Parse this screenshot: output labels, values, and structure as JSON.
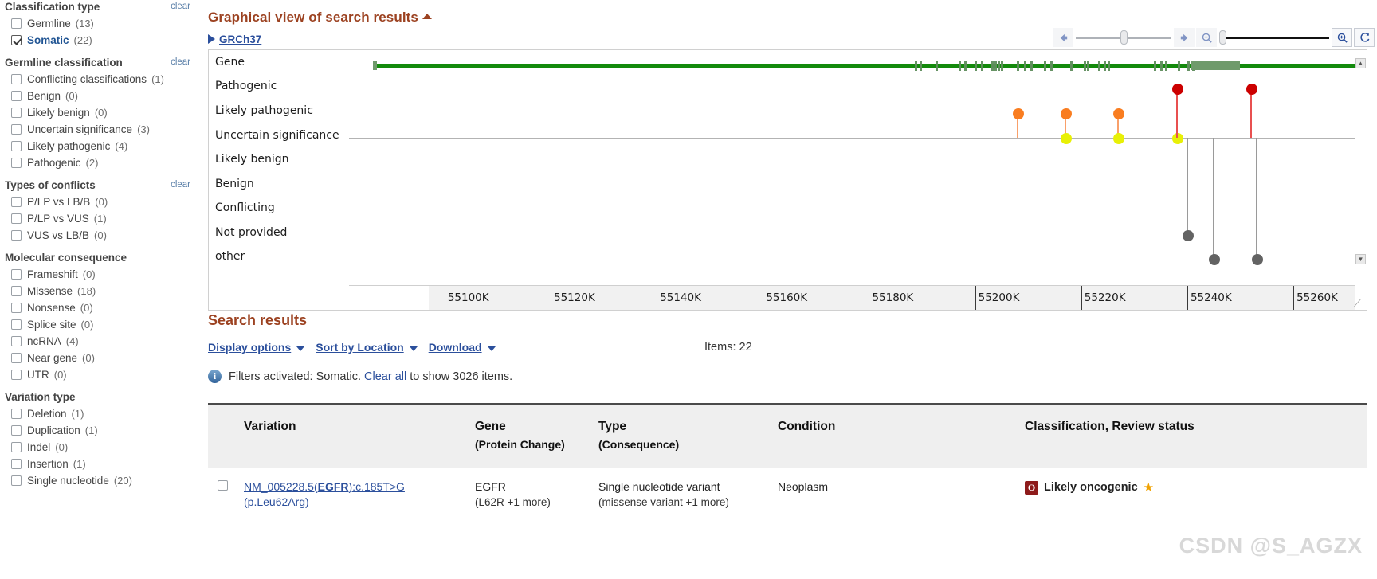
{
  "sidebar": {
    "groups": [
      {
        "title": "Classification type",
        "clear": "clear",
        "items": [
          {
            "label": "Germline",
            "count": "(13)",
            "checked": false
          },
          {
            "label": "Somatic",
            "count": "(22)",
            "checked": true
          }
        ]
      },
      {
        "title": "Germline classification",
        "clear": "clear",
        "items": [
          {
            "label": "Conflicting classifications",
            "count": "(1)",
            "checked": false
          },
          {
            "label": "Benign",
            "count": "(0)",
            "checked": false
          },
          {
            "label": "Likely benign",
            "count": "(0)",
            "checked": false
          },
          {
            "label": "Uncertain significance",
            "count": "(3)",
            "checked": false
          },
          {
            "label": "Likely pathogenic",
            "count": "(4)",
            "checked": false
          },
          {
            "label": "Pathogenic",
            "count": "(2)",
            "checked": false
          }
        ]
      },
      {
        "title": "Types of conflicts",
        "clear": "clear",
        "items": [
          {
            "label": "P/LP vs LB/B",
            "count": "(0)",
            "checked": false
          },
          {
            "label": "P/LP vs VUS",
            "count": "(1)",
            "checked": false
          },
          {
            "label": "VUS vs LB/B",
            "count": "(0)",
            "checked": false
          }
        ]
      },
      {
        "title": "Molecular consequence",
        "clear": "",
        "items": [
          {
            "label": "Frameshift",
            "count": "(0)",
            "checked": false
          },
          {
            "label": "Missense",
            "count": "(18)",
            "checked": false
          },
          {
            "label": "Nonsense",
            "count": "(0)",
            "checked": false
          },
          {
            "label": "Splice site",
            "count": "(0)",
            "checked": false
          },
          {
            "label": "ncRNA",
            "count": "(4)",
            "checked": false
          },
          {
            "label": "Near gene",
            "count": "(0)",
            "checked": false
          },
          {
            "label": "UTR",
            "count": "(0)",
            "checked": false
          }
        ]
      },
      {
        "title": "Variation type",
        "clear": "",
        "items": [
          {
            "label": "Deletion",
            "count": "(1)",
            "checked": false
          },
          {
            "label": "Duplication",
            "count": "(1)",
            "checked": false
          },
          {
            "label": "Indel",
            "count": "(0)",
            "checked": false
          },
          {
            "label": "Insertion",
            "count": "(1)",
            "checked": false
          },
          {
            "label": "Single nucleotide",
            "count": "(20)",
            "checked": false
          }
        ]
      }
    ]
  },
  "graphical_view": {
    "title": "Graphical view of search results",
    "collapse_icon": "caret-up-icon",
    "assembly": "GRCh37",
    "assembly_icon": "triangle-right-icon",
    "toolbar": {
      "pan_left_icon": "arrow-left-icon",
      "pan_right_icon": "arrow-right-icon",
      "zoom_out_icon": "magnifier-minus-icon",
      "zoom_in_icon": "magnifier-plus-icon",
      "reset_icon": "refresh-icon"
    }
  },
  "chart_data": {
    "type": "scatter",
    "title": "Graphical view of search results",
    "xlabel": "",
    "ylabel": "",
    "grid": false,
    "legend": "none",
    "xlim": [
      55082000,
      55272000
    ],
    "x_tick_labels": [
      "55100K",
      "55120K",
      "55140K",
      "55160K",
      "55180K",
      "55200K",
      "55220K",
      "55240K",
      "55260K"
    ],
    "x_tick_values": [
      55100000,
      55120000,
      55140000,
      55160000,
      55180000,
      55200000,
      55220000,
      55240000,
      55260000
    ],
    "tracks": [
      "Gene",
      "Pathogenic",
      "Likely pathogenic",
      "Uncertain significance",
      "Likely benign",
      "Benign",
      "Conflicting",
      "Not provided",
      "other"
    ],
    "gene_track": {
      "name": "EGFR",
      "color": "#138a0c",
      "start": 55086714,
      "end": 55279321
    },
    "markers": [
      {
        "track": "Likely pathogenic",
        "x": 55208000,
        "color": "#f97d20"
      },
      {
        "track": "Likely pathogenic",
        "x": 55217000,
        "color": "#f97d20"
      },
      {
        "track": "Uncertain significance",
        "x": 55217000,
        "color": "#e8f006"
      },
      {
        "track": "Likely pathogenic",
        "x": 55227000,
        "color": "#f97d20"
      },
      {
        "track": "Uncertain significance",
        "x": 55227000,
        "color": "#e8f006"
      },
      {
        "track": "Uncertain significance",
        "x": 55238000,
        "color": "#e8f006"
      },
      {
        "track": "Pathogenic",
        "x": 55238000,
        "color": "#cc0000"
      },
      {
        "track": "Not provided",
        "x": 55240000,
        "color": "#636363"
      },
      {
        "track": "other",
        "x": 55245000,
        "color": "#636363"
      },
      {
        "track": "other",
        "x": 55253000,
        "color": "#636363"
      },
      {
        "track": "Pathogenic",
        "x": 55252000,
        "color": "#cc0000"
      }
    ]
  },
  "search_results": {
    "title": "Search results",
    "display_options": "Display options",
    "sort_by": "Sort by Location",
    "download": "Download",
    "items_count": "Items: 22",
    "filters_note_prefix": "Filters activated: Somatic.",
    "clear_all": "Clear all",
    "filters_note_suffix": "to show 3026 items.",
    "columns": [
      {
        "label": "Variation",
        "sub": ""
      },
      {
        "label": "Gene",
        "sub": "(Protein Change)"
      },
      {
        "label": "Type",
        "sub": "(Consequence)"
      },
      {
        "label": "Condition",
        "sub": ""
      },
      {
        "label": "Classification, Review status",
        "sub": ""
      }
    ],
    "rows": [
      {
        "variation_prefix": "NM_005228.5(",
        "variation_gene": "EGFR",
        "variation_suffix": "):c.185T>G (p.Leu62Arg)",
        "gene": "EGFR",
        "protein_change": "(L62R +1 more)",
        "type": "Single nucleotide variant",
        "consequence": "(missense variant +1 more)",
        "condition": "Neoplasm",
        "classification": "Likely oncogenic",
        "classification_badge": "O",
        "review_star": "★"
      }
    ]
  },
  "watermark": "CSDN @S_AGZX",
  "colors": {
    "heading": "#9c4221",
    "link": "#2b4f9c",
    "gene": "#138a0c",
    "pathogenic": "#cc0000",
    "likely_pathogenic": "#f97d20",
    "uncertain": "#e8f006",
    "other": "#636363"
  }
}
